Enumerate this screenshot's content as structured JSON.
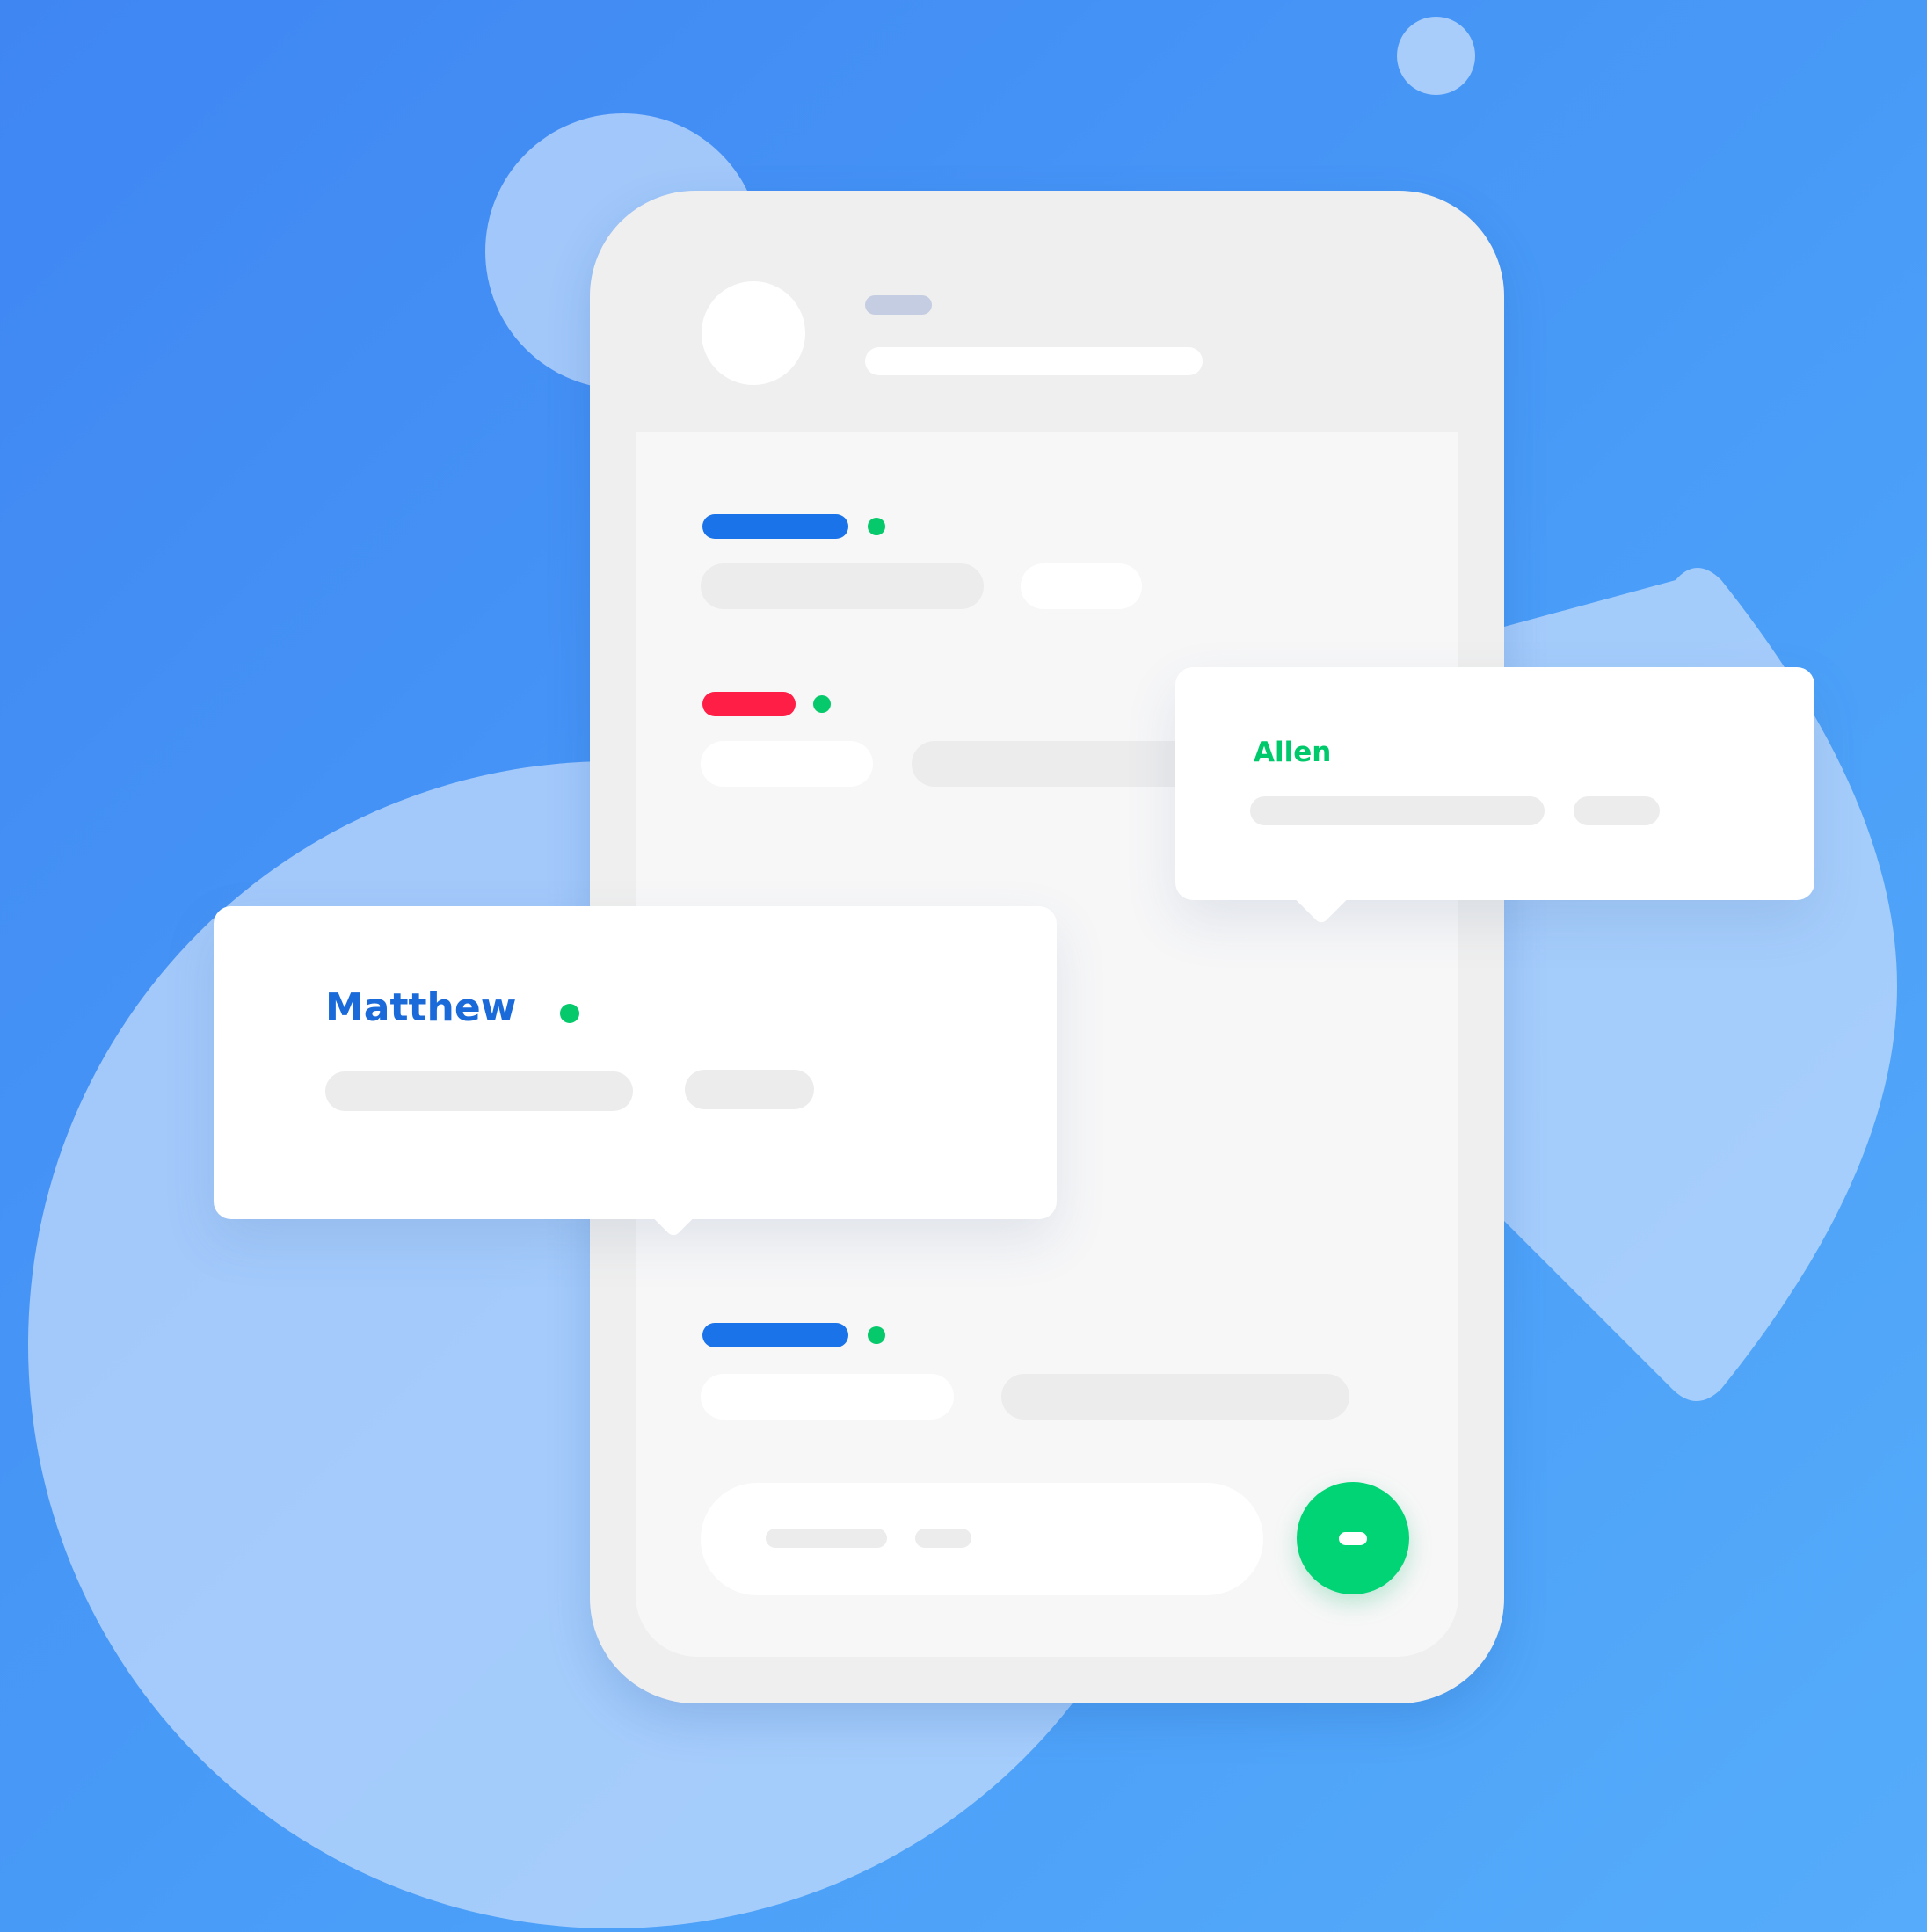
{
  "colors": {
    "background": "#4290f5",
    "accent_blue": "#1a73e8",
    "accent_red": "#ff1e45",
    "online_green": "#06c96b",
    "send_green": "#00d474"
  },
  "conversation": {
    "messages": [
      {
        "sender_color": "accent_blue",
        "online": true
      },
      {
        "sender_color": "accent_red",
        "online": true
      },
      {
        "sender_color": "accent_blue",
        "online": true
      }
    ]
  },
  "popups": {
    "matthew": {
      "name": "Matthew",
      "name_color": "#1a6bd9",
      "online": true
    },
    "allen": {
      "name": "Allen",
      "name_color": "#00c96b"
    }
  },
  "composer": {
    "send_icon": "send-icon"
  }
}
